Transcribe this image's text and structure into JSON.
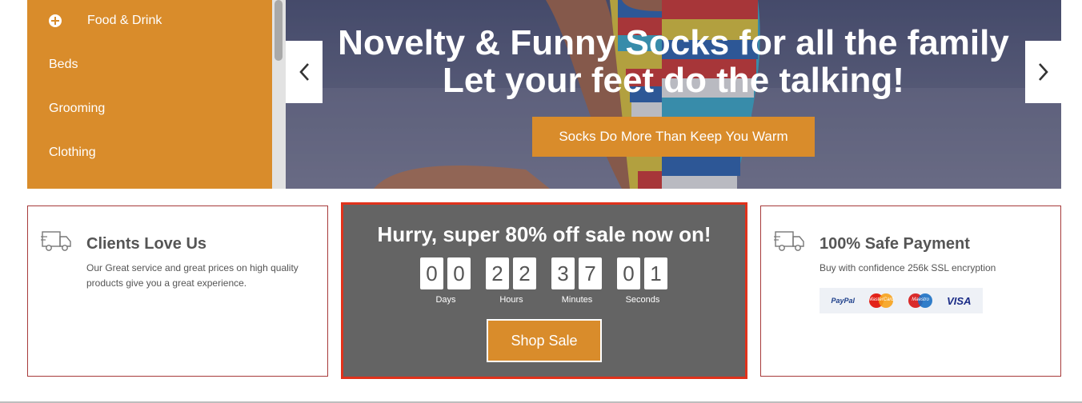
{
  "sidebar": {
    "items": [
      {
        "label": "Food & Drink",
        "icon": "plus-circle-icon"
      },
      {
        "label": "Beds"
      },
      {
        "label": "Grooming"
      },
      {
        "label": "Clothing"
      }
    ]
  },
  "hero": {
    "title": "Novelty & Funny Socks for all the family Let your feet do the talking!",
    "cta": "Socks Do More Than Keep You Warm",
    "prev_icon": "chevron-left-icon",
    "next_icon": "chevron-right-icon"
  },
  "features": [
    {
      "icon": "truck-icon",
      "title": "Clients Love Us",
      "text": "Our Great service and great prices on high quality products give you a great experience."
    },
    {
      "icon": "truck-icon",
      "title": "100% Safe Payment",
      "text": "Buy with confidence 256k SSL encryption"
    }
  ],
  "sale": {
    "title": "Hurry, super 80% off sale now on!",
    "countdown": [
      {
        "label": "Days",
        "digits": [
          "0",
          "0"
        ]
      },
      {
        "label": "Hours",
        "digits": [
          "2",
          "2"
        ]
      },
      {
        "label": "Minutes",
        "digits": [
          "3",
          "7"
        ]
      },
      {
        "label": "Seconds",
        "digits": [
          "0",
          "1"
        ]
      }
    ],
    "button": "Shop Sale"
  },
  "payments": {
    "paypal": "PayPal",
    "mastercard": "MasterCard",
    "maestro": "Maestro",
    "visa": "VISA"
  },
  "colors": {
    "accent": "#d98c2b",
    "sale_background": "#646464",
    "sale_border": "#e0321c",
    "box_border": "#a73a3a"
  }
}
